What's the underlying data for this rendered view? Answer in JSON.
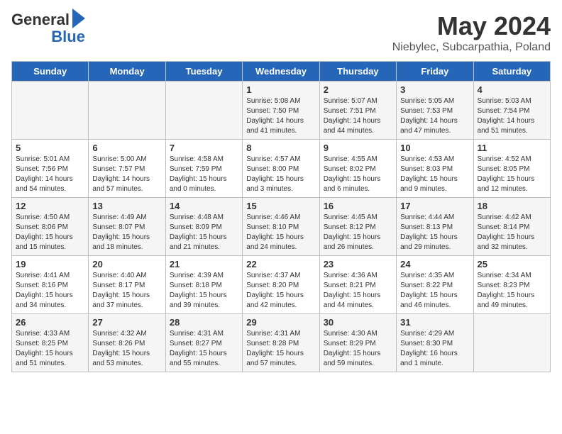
{
  "header": {
    "logo_general": "General",
    "logo_blue": "Blue",
    "title": "May 2024",
    "subtitle": "Niebylec, Subcarpathia, Poland"
  },
  "days_of_week": [
    "Sunday",
    "Monday",
    "Tuesday",
    "Wednesday",
    "Thursday",
    "Friday",
    "Saturday"
  ],
  "weeks": [
    {
      "days": [
        {
          "num": "",
          "info": ""
        },
        {
          "num": "",
          "info": ""
        },
        {
          "num": "",
          "info": ""
        },
        {
          "num": "1",
          "info": "Sunrise: 5:08 AM\nSunset: 7:50 PM\nDaylight: 14 hours\nand 41 minutes."
        },
        {
          "num": "2",
          "info": "Sunrise: 5:07 AM\nSunset: 7:51 PM\nDaylight: 14 hours\nand 44 minutes."
        },
        {
          "num": "3",
          "info": "Sunrise: 5:05 AM\nSunset: 7:53 PM\nDaylight: 14 hours\nand 47 minutes."
        },
        {
          "num": "4",
          "info": "Sunrise: 5:03 AM\nSunset: 7:54 PM\nDaylight: 14 hours\nand 51 minutes."
        }
      ]
    },
    {
      "days": [
        {
          "num": "5",
          "info": "Sunrise: 5:01 AM\nSunset: 7:56 PM\nDaylight: 14 hours\nand 54 minutes."
        },
        {
          "num": "6",
          "info": "Sunrise: 5:00 AM\nSunset: 7:57 PM\nDaylight: 14 hours\nand 57 minutes."
        },
        {
          "num": "7",
          "info": "Sunrise: 4:58 AM\nSunset: 7:59 PM\nDaylight: 15 hours\nand 0 minutes."
        },
        {
          "num": "8",
          "info": "Sunrise: 4:57 AM\nSunset: 8:00 PM\nDaylight: 15 hours\nand 3 minutes."
        },
        {
          "num": "9",
          "info": "Sunrise: 4:55 AM\nSunset: 8:02 PM\nDaylight: 15 hours\nand 6 minutes."
        },
        {
          "num": "10",
          "info": "Sunrise: 4:53 AM\nSunset: 8:03 PM\nDaylight: 15 hours\nand 9 minutes."
        },
        {
          "num": "11",
          "info": "Sunrise: 4:52 AM\nSunset: 8:05 PM\nDaylight: 15 hours\nand 12 minutes."
        }
      ]
    },
    {
      "days": [
        {
          "num": "12",
          "info": "Sunrise: 4:50 AM\nSunset: 8:06 PM\nDaylight: 15 hours\nand 15 minutes."
        },
        {
          "num": "13",
          "info": "Sunrise: 4:49 AM\nSunset: 8:07 PM\nDaylight: 15 hours\nand 18 minutes."
        },
        {
          "num": "14",
          "info": "Sunrise: 4:48 AM\nSunset: 8:09 PM\nDaylight: 15 hours\nand 21 minutes."
        },
        {
          "num": "15",
          "info": "Sunrise: 4:46 AM\nSunset: 8:10 PM\nDaylight: 15 hours\nand 24 minutes."
        },
        {
          "num": "16",
          "info": "Sunrise: 4:45 AM\nSunset: 8:12 PM\nDaylight: 15 hours\nand 26 minutes."
        },
        {
          "num": "17",
          "info": "Sunrise: 4:44 AM\nSunset: 8:13 PM\nDaylight: 15 hours\nand 29 minutes."
        },
        {
          "num": "18",
          "info": "Sunrise: 4:42 AM\nSunset: 8:14 PM\nDaylight: 15 hours\nand 32 minutes."
        }
      ]
    },
    {
      "days": [
        {
          "num": "19",
          "info": "Sunrise: 4:41 AM\nSunset: 8:16 PM\nDaylight: 15 hours\nand 34 minutes."
        },
        {
          "num": "20",
          "info": "Sunrise: 4:40 AM\nSunset: 8:17 PM\nDaylight: 15 hours\nand 37 minutes."
        },
        {
          "num": "21",
          "info": "Sunrise: 4:39 AM\nSunset: 8:18 PM\nDaylight: 15 hours\nand 39 minutes."
        },
        {
          "num": "22",
          "info": "Sunrise: 4:37 AM\nSunset: 8:20 PM\nDaylight: 15 hours\nand 42 minutes."
        },
        {
          "num": "23",
          "info": "Sunrise: 4:36 AM\nSunset: 8:21 PM\nDaylight: 15 hours\nand 44 minutes."
        },
        {
          "num": "24",
          "info": "Sunrise: 4:35 AM\nSunset: 8:22 PM\nDaylight: 15 hours\nand 46 minutes."
        },
        {
          "num": "25",
          "info": "Sunrise: 4:34 AM\nSunset: 8:23 PM\nDaylight: 15 hours\nand 49 minutes."
        }
      ]
    },
    {
      "days": [
        {
          "num": "26",
          "info": "Sunrise: 4:33 AM\nSunset: 8:25 PM\nDaylight: 15 hours\nand 51 minutes."
        },
        {
          "num": "27",
          "info": "Sunrise: 4:32 AM\nSunset: 8:26 PM\nDaylight: 15 hours\nand 53 minutes."
        },
        {
          "num": "28",
          "info": "Sunrise: 4:31 AM\nSunset: 8:27 PM\nDaylight: 15 hours\nand 55 minutes."
        },
        {
          "num": "29",
          "info": "Sunrise: 4:31 AM\nSunset: 8:28 PM\nDaylight: 15 hours\nand 57 minutes."
        },
        {
          "num": "30",
          "info": "Sunrise: 4:30 AM\nSunset: 8:29 PM\nDaylight: 15 hours\nand 59 minutes."
        },
        {
          "num": "31",
          "info": "Sunrise: 4:29 AM\nSunset: 8:30 PM\nDaylight: 16 hours\nand 1 minute."
        },
        {
          "num": "",
          "info": ""
        }
      ]
    }
  ]
}
